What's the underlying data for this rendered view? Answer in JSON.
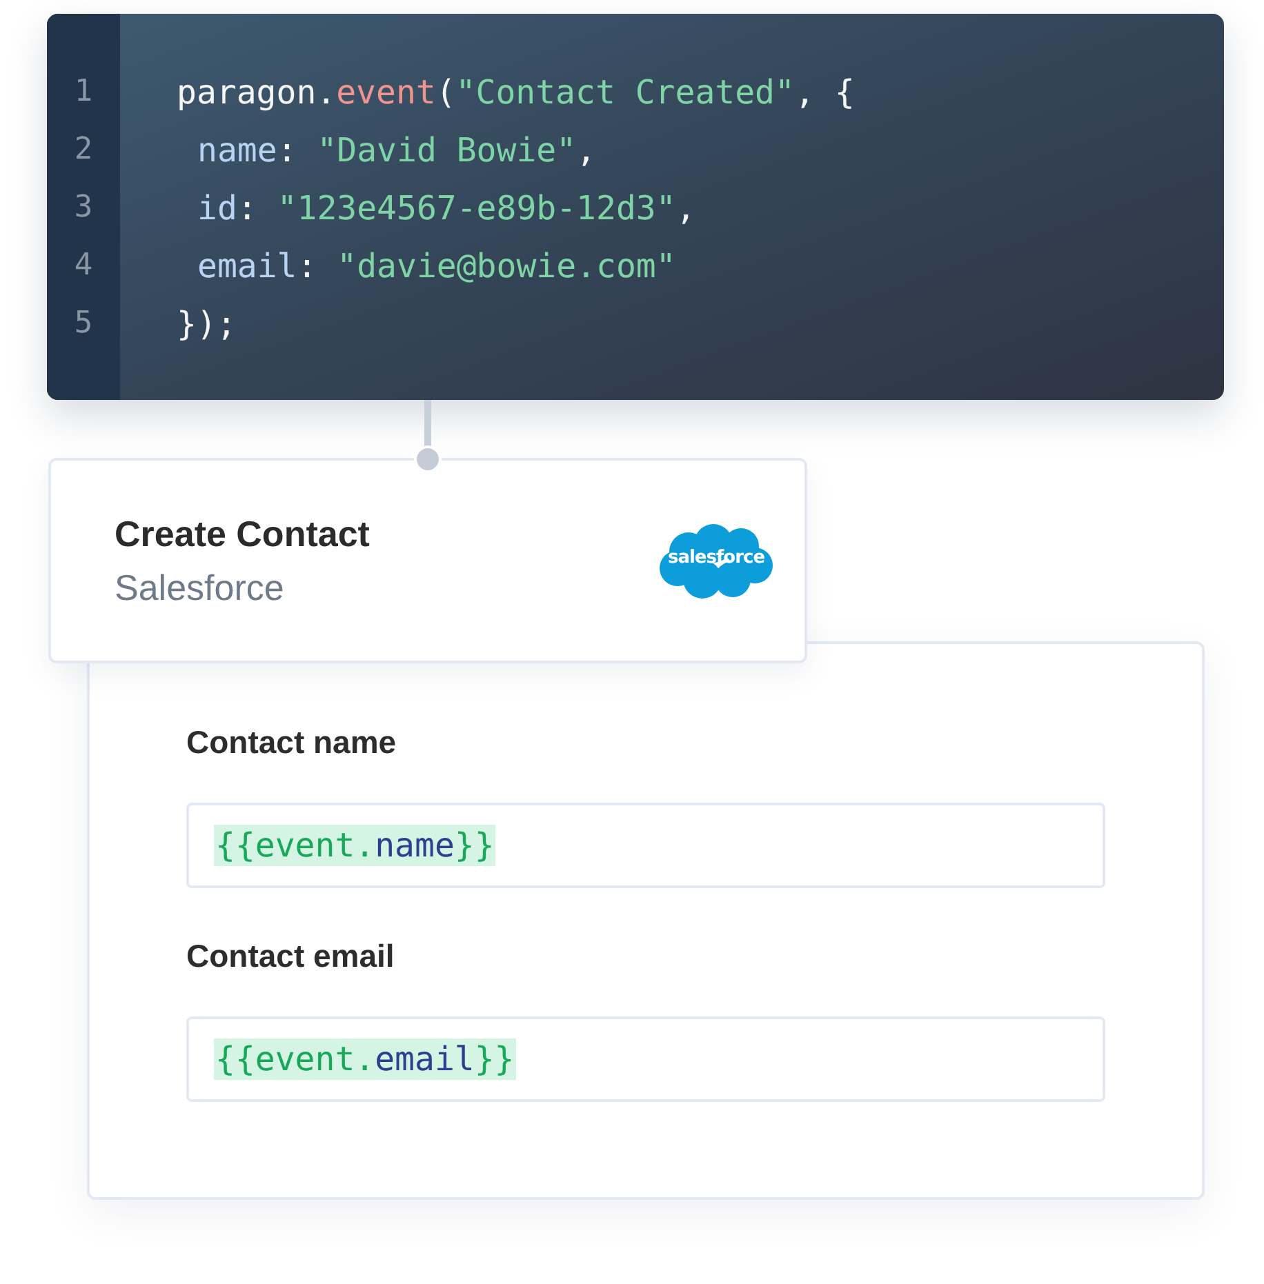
{
  "code": {
    "lines": [
      {
        "number": "1",
        "indented": false,
        "tokens": [
          {
            "kind": "plain",
            "text": "paragon."
          },
          {
            "kind": "method",
            "text": "event"
          },
          {
            "kind": "plain",
            "text": "("
          },
          {
            "kind": "string",
            "text": "\"Contact Created\""
          },
          {
            "kind": "plain",
            "text": ", {"
          }
        ]
      },
      {
        "number": "2",
        "indented": true,
        "tokens": [
          {
            "kind": "key",
            "text": "name"
          },
          {
            "kind": "plain",
            "text": ": "
          },
          {
            "kind": "string",
            "text": "\"David Bowie\""
          },
          {
            "kind": "plain",
            "text": ","
          }
        ]
      },
      {
        "number": "3",
        "indented": true,
        "tokens": [
          {
            "kind": "key",
            "text": "id"
          },
          {
            "kind": "plain",
            "text": ": "
          },
          {
            "kind": "string",
            "text": "\"123e4567-e89b-12d3\""
          },
          {
            "kind": "plain",
            "text": ","
          }
        ]
      },
      {
        "number": "4",
        "indented": true,
        "tokens": [
          {
            "kind": "key",
            "text": "email"
          },
          {
            "kind": "plain",
            "text": ": "
          },
          {
            "kind": "string",
            "text": "\"davie@bowie.com\""
          }
        ]
      },
      {
        "number": "5",
        "indented": false,
        "tokens": [
          {
            "kind": "plain",
            "text": "});"
          }
        ]
      }
    ]
  },
  "action": {
    "title": "Create Contact",
    "app": "Salesforce",
    "logo_text": "salesforce"
  },
  "fields": [
    {
      "label": "Contact name",
      "tokens": [
        {
          "kind": "brace",
          "text": "{{event."
        },
        {
          "kind": "path",
          "text": "name"
        },
        {
          "kind": "brace",
          "text": "}}"
        }
      ]
    },
    {
      "label": "Contact email",
      "tokens": [
        {
          "kind": "brace",
          "text": "{{event."
        },
        {
          "kind": "path",
          "text": "email"
        },
        {
          "kind": "brace",
          "text": "}}"
        }
      ]
    }
  ]
}
